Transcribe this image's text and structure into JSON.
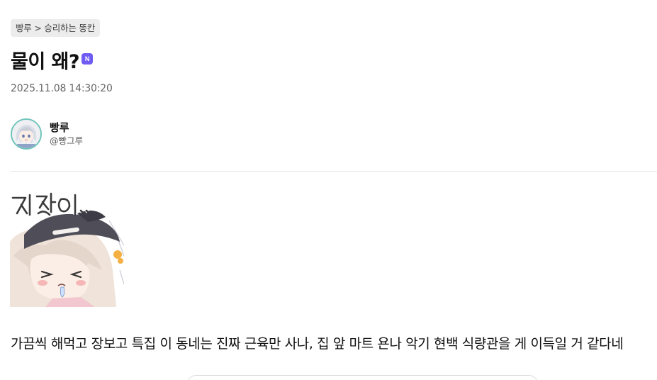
{
  "post": {
    "breadcrumb": "빵루 > 승리하는 똥칸",
    "title": "물이 왜?",
    "new_badge": "N",
    "timestamp": "2025.11.08 14:30:20",
    "author": {
      "name": "빵루",
      "handle": "@빵그루"
    },
    "sticker": {
      "caption": "지쳤어..",
      "icon": "tired-character-sticker"
    },
    "body": "가끔씩 해먹고 장보고 특집 이 동네는 진짜 근육만 사나, 집 앞 마트 욘나 악기 현백 식량관을 게 이득일 거 같다네"
  },
  "colors": {
    "badge": "#6f5cf2",
    "breadcrumb_bg": "#ececec",
    "avatar_ring": "#6ec4b8"
  }
}
